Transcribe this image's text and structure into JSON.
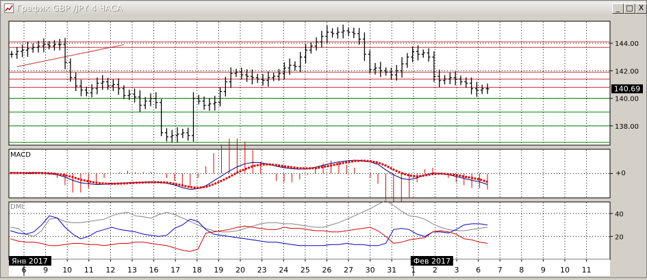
{
  "window": {
    "title": "График GBP /JPY  4 ЧАСА",
    "buttons": {
      "minimize": "_",
      "restore": "□",
      "close": "X"
    }
  },
  "colors": {
    "background": "#ffffff",
    "grid": "#000000",
    "resistance_lines": "#c83232",
    "support_lines": "#008000",
    "price_bars": "#000000",
    "price_label_bg": "#000000",
    "macd_line": "#000080",
    "macd_signal": "#dd0000",
    "macd_histogram": "#dd0000",
    "dmi_adx": "#808080",
    "dmi_plus": "#0000c0",
    "dmi_minus": "#d00000"
  },
  "chart_data": [
    {
      "type": "ohlc",
      "name": "price",
      "current_price": "140.69",
      "ylim": [
        136.6,
        145.6
      ],
      "y_ticks": [
        "144.00",
        "142.00",
        "140.00",
        "138.00"
      ],
      "resistance_levels": [
        144.1,
        143.7,
        141.9,
        141.4,
        140.8
      ],
      "support_levels": [
        140.0,
        139.0,
        138.0,
        136.8
      ],
      "trendline": {
        "from": [
          1,
          142.3
        ],
        "to": [
          21,
          143.9
        ]
      },
      "x_tick_labels": [
        "6",
        "9",
        "10",
        "11",
        "12",
        "13",
        "16",
        "17",
        "18",
        "19",
        "20",
        "23",
        "24",
        "25",
        "26",
        "27",
        "30",
        "31",
        "1",
        "2",
        "3",
        "6",
        "7",
        "8",
        "9",
        "10",
        "11"
      ],
      "month_labels": [
        {
          "text": "Янв 2017",
          "at": 0
        },
        {
          "text": "Фев 2017",
          "at": 18
        }
      ],
      "close": [
        143.2,
        143.4,
        143.5,
        143.6,
        143.7,
        143.8,
        143.9,
        143.8,
        143.9,
        143.9,
        142.6,
        141.5,
        140.9,
        140.6,
        140.4,
        140.7,
        141.1,
        141.2,
        140.9,
        141.0,
        140.7,
        140.2,
        140.3,
        140.1,
        139.5,
        139.8,
        140.0,
        139.7,
        137.5,
        137.2,
        137.3,
        137.4,
        137.5,
        137.3,
        140.0,
        139.8,
        139.5,
        139.6,
        139.7,
        140.5,
        141.2,
        141.8,
        141.9,
        141.7,
        141.6,
        141.5,
        141.4,
        141.3,
        141.5,
        141.6,
        141.8,
        142.2,
        142.4,
        142.3,
        143.0,
        143.5,
        143.8,
        144.1,
        144.5,
        144.8,
        144.7,
        144.8,
        144.9,
        144.8,
        144.7,
        144.3,
        143.2,
        142.1,
        142.2,
        142.0,
        141.9,
        141.7,
        142.0,
        142.5,
        143.0,
        143.4,
        143.2,
        143.3,
        143.0,
        141.6,
        141.3,
        141.4,
        141.5,
        141.4,
        141.2,
        141.1,
        140.7,
        140.6,
        140.7,
        140.69
      ]
    },
    {
      "type": "line",
      "name": "MACD",
      "y_label": "+0",
      "ylim": [
        -1.0,
        1.0
      ],
      "series": [
        {
          "name": "",
          "values": [
            0.03,
            0.02,
            0.02,
            0.03,
            0.02,
            0.0,
            -0.05,
            -0.15,
            -0.28,
            -0.38,
            -0.42,
            -0.45,
            -0.44,
            -0.42,
            -0.4,
            -0.38,
            -0.37,
            -0.36,
            -0.35,
            -0.36,
            -0.4,
            -0.47,
            -0.58,
            -0.65,
            -0.62,
            -0.5,
            -0.3,
            -0.1,
            0.1,
            0.28,
            0.4,
            0.46,
            0.45,
            0.38,
            0.3,
            0.24,
            0.2,
            0.18,
            0.2,
            0.26,
            0.34,
            0.42,
            0.48,
            0.52,
            0.55,
            0.53,
            0.48,
            0.38,
            0.15,
            -0.05,
            -0.2,
            -0.25,
            -0.18,
            -0.05,
            0.02,
            0.0,
            -0.05,
            -0.12,
            -0.2,
            -0.28,
            -0.34,
            -0.45
          ]
        },
        {
          "name": "",
          "values": [
            0.02,
            0.02,
            0.02,
            0.02,
            0.02,
            0.01,
            -0.02,
            -0.07,
            -0.15,
            -0.25,
            -0.32,
            -0.38,
            -0.41,
            -0.42,
            -0.41,
            -0.4,
            -0.38,
            -0.37,
            -0.36,
            -0.36,
            -0.37,
            -0.42,
            -0.49,
            -0.56,
            -0.59,
            -0.55,
            -0.44,
            -0.3,
            -0.14,
            0.04,
            0.18,
            0.3,
            0.37,
            0.38,
            0.35,
            0.3,
            0.26,
            0.22,
            0.21,
            0.22,
            0.27,
            0.33,
            0.4,
            0.46,
            0.51,
            0.53,
            0.51,
            0.45,
            0.33,
            0.16,
            0.02,
            -0.08,
            -0.12,
            -0.08,
            -0.02,
            0.0,
            -0.02,
            -0.06,
            -0.12,
            -0.18,
            -0.24,
            -0.34
          ]
        }
      ]
    },
    {
      "type": "line",
      "name": "DMI",
      "ylim": [
        0,
        50
      ],
      "y_ticks": [
        "40",
        "20"
      ],
      "series": [
        {
          "name": "",
          "values": [
            28,
            27,
            22,
            20,
            25,
            35,
            36,
            33,
            32,
            32,
            33,
            34,
            35,
            38,
            40,
            41,
            38,
            37,
            36,
            39,
            41,
            39,
            36,
            33,
            30,
            27,
            25,
            24,
            24,
            25,
            27,
            29,
            31,
            32,
            32,
            31,
            31,
            30,
            29,
            28,
            28,
            30,
            32,
            35,
            38,
            41,
            44,
            48,
            51,
            47,
            42,
            38,
            37,
            35,
            31,
            28,
            26,
            25,
            25,
            26,
            27,
            28
          ]
        },
        {
          "name": "",
          "values": [
            25,
            23,
            22,
            24,
            30,
            38,
            36,
            28,
            22,
            18,
            20,
            24,
            26,
            28,
            26,
            25,
            24,
            22,
            21,
            20,
            21,
            27,
            30,
            35,
            33,
            26,
            22,
            21,
            20,
            19,
            18,
            17,
            16,
            15,
            15,
            14,
            13,
            12,
            12,
            12,
            12,
            13,
            13,
            14,
            13,
            13,
            12,
            12,
            14,
            26,
            27,
            26,
            22,
            20,
            24,
            24,
            23,
            26,
            30,
            31,
            31,
            30
          ]
        },
        {
          "name": "",
          "values": [
            18,
            16,
            15,
            15,
            14,
            12,
            12,
            13,
            14,
            14,
            13,
            13,
            12,
            13,
            14,
            14,
            15,
            15,
            14,
            13,
            12,
            10,
            8,
            7,
            9,
            23,
            24,
            25,
            26,
            28,
            29,
            28,
            27,
            26,
            26,
            28,
            27,
            27,
            26,
            25,
            25,
            24,
            24,
            25,
            26,
            27,
            28,
            25,
            20,
            14,
            15,
            17,
            18,
            19,
            24,
            25,
            24,
            22,
            18,
            17,
            15,
            14
          ]
        }
      ]
    }
  ]
}
